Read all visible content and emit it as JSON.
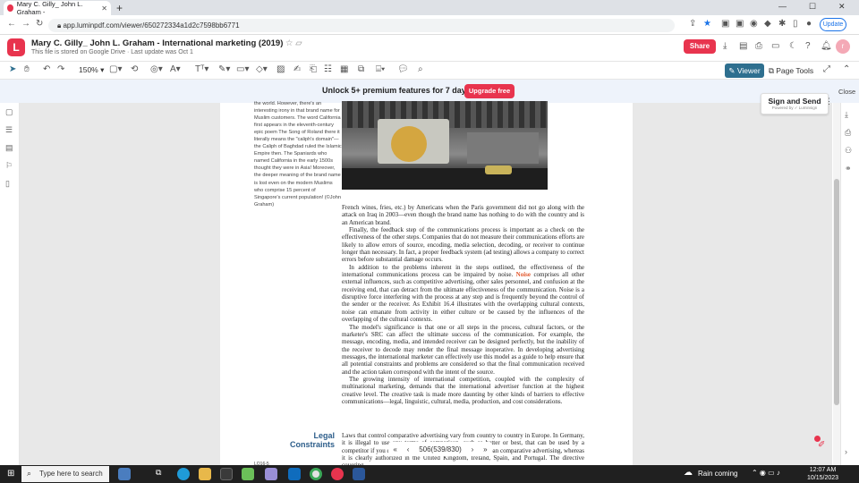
{
  "browser": {
    "tab_title": "Mary C. Gilly_ John L. Graham -",
    "url": "app.luminpdf.com/viewer/650272334a1d2c7598bb6771",
    "update_label": "Update",
    "new_tab": "+"
  },
  "app": {
    "logo_letter": "L",
    "doc_title": "Mary C. Gilly_ John L. Graham - International marketing (2019)",
    "doc_subtitle": "This file is stored on Google Drive · Last update was Oct 1",
    "share_label": "Share",
    "avatar_letter": "r"
  },
  "toolbar": {
    "zoom": "150%",
    "viewer_label": "Viewer",
    "page_tools_label": "Page Tools"
  },
  "promo": {
    "text": "Unlock 5+ premium features for 7 days free",
    "button": "Upgrade free",
    "sign_title": "Sign and Send",
    "sign_powered": "Powered by ✓ Luminsign",
    "close": "Close"
  },
  "document": {
    "sidenote": "the world. However, there's an interesting irony in that brand name for Muslim customers. The word California first appears in the eleventh-century epic poem The Song of Roland there it literally means the \"caliph's domain\"—the Caliph of Baghdad ruled the Islamic Empire then. The Spaniards who named California in the early 1500s thought they were in Asia! Moreover, the deeper meaning of the brand name is lost even on the modern Muslims who comprise 15 percent of Singapore's current population! (©John Graham)",
    "p1": "French wines, fries, etc.) by Americans when the Paris government did not go along with the attack on Iraq in 2003—even though the brand name has nothing to do with the country and is an American brand.",
    "p2": "Finally, the feedback step of the communications process is important as a check on the effectiveness of the other steps. Companies that do not measure their communications efforts are likely to allow errors of source, encoding, media selection, decoding, or receiver to continue longer than necessary. In fact, a proper feedback system (ad testing) allows a company to correct errors before substantial damage occurs.",
    "p3_before": "In addition to the problems inherent in the steps outlined, the effectiveness of the international communications process can be impaired by noise.",
    "p3_keyword": "Noise",
    "p3_after": "comprises all other external influences, such as competitive advertising, other sales personnel, and confusion at the receiving end, that can detract from the ultimate effectiveness of the communication. Noise is a disruptive force interfering with the process at any step and is frequently beyond the control of the sender or the receiver. As Exhibit 16.4 illustrates with the overlapping cultural contexts, noise can emanate from activity in either culture or be caused by the influences of the overlapping of the cultural contexts.",
    "p4": "The model's significance is that one or all steps in the process, cultural factors, or the marketer's SRC can affect the ultimate success of the communication. For example, the message, encoding, media, and intended receiver can be designed perfectly, but the inability of the receiver to decode may render the final message inoperative. In developing advertising messages, the international marketer can effectively use this model as a guide to help ensure that all potential constraints and problems are considered so that the final communication received and the action taken correspond with the intent of the source.",
    "p5": "The growing intensity of international competition, coupled with the complexity of multinational marketing, demands that the international advertiser function at the highest creative level. The creative task is made more daunting by other kinds of barriers to effective communications—legal, linguistic, cultural, media, production, and cost considerations.",
    "section_heading": "Legal Constraints",
    "legal_text": "Laws that control comparative advertising vary from country to country in Europe. In Germany, it is illegal to use any terms of comparison, such as better or best, that can be used by a competitor if you do. Belgium and Luxembourg explicitly ban comparative advertising, whereas it is clearly authorized in the United Kingdom, Ireland, Spain, and Portugal. The directive covering",
    "footer_label": "LO16-5"
  },
  "pager": {
    "first": "«",
    "prev": "‹",
    "page_text": "506(539/830)",
    "next": "›",
    "last": "»"
  },
  "taskbar": {
    "search_placeholder": "Type here to search",
    "weather": "Rain coming",
    "time": "12:07 AM",
    "date": "10/15/2023"
  },
  "colors": {
    "brand": "#e8344e",
    "viewer_active": "#2e6f8f",
    "section_heading": "#2c5d8a",
    "keyword": "#e2562b"
  }
}
